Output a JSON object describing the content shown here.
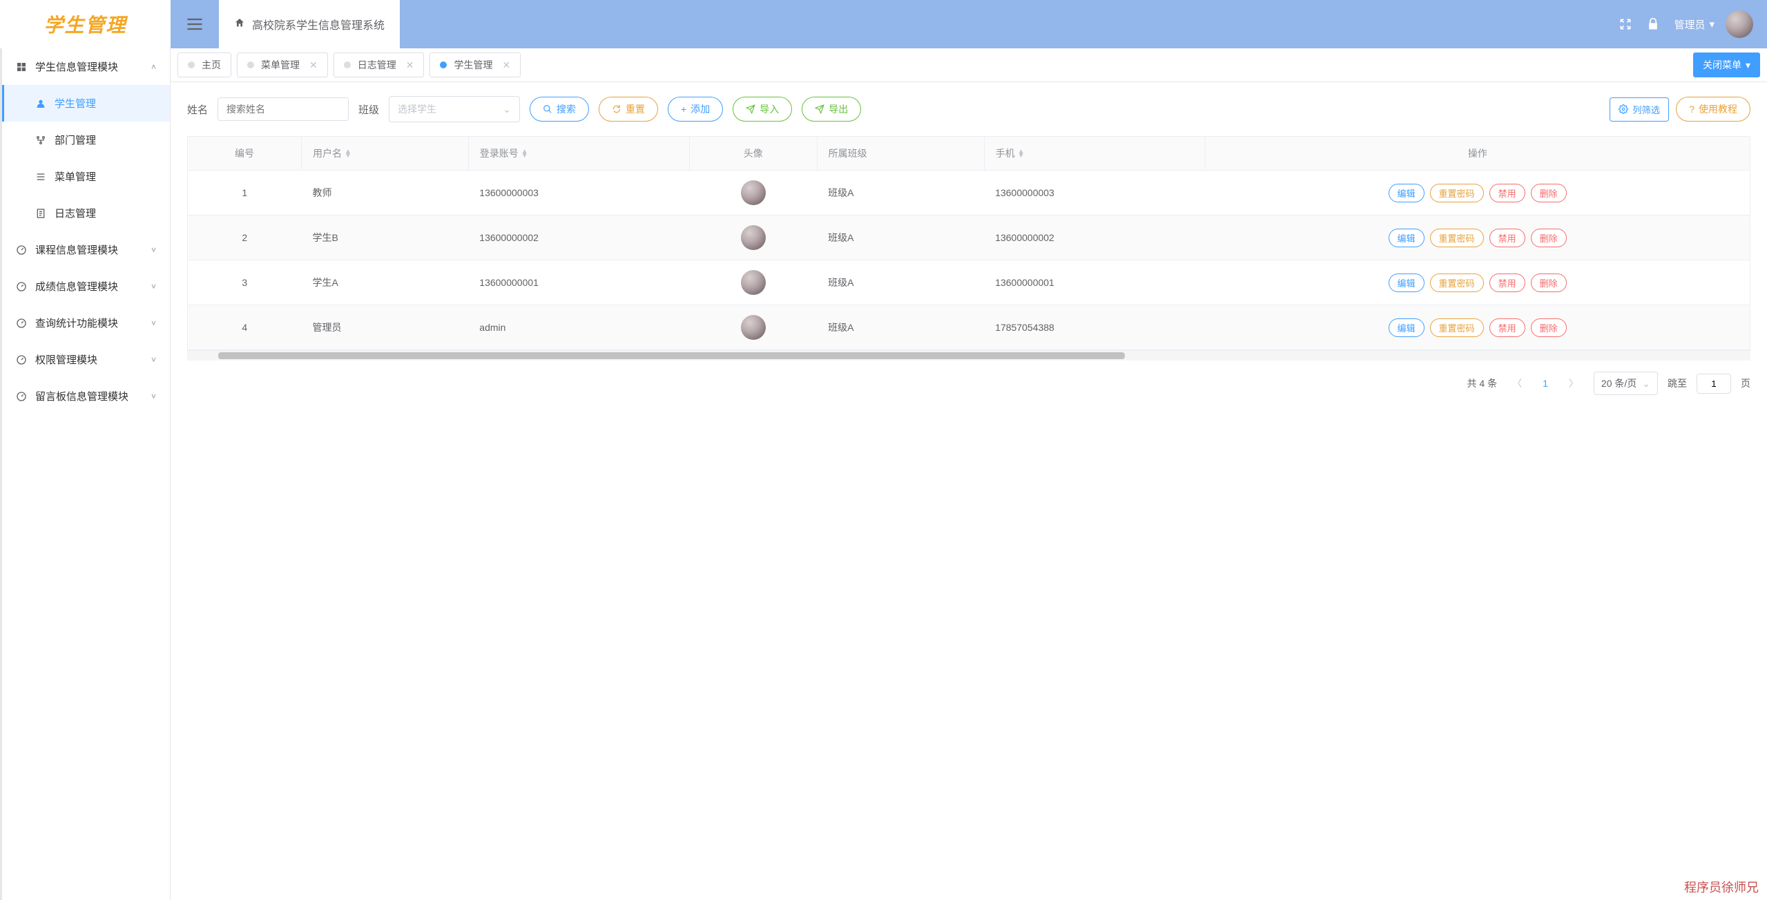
{
  "logo": "学生管理",
  "breadcrumb": "高校院系学生信息管理系统",
  "header": {
    "user_label": "管理员"
  },
  "sidebar": {
    "groups": [
      {
        "label": "学生信息管理模块",
        "expanded": true,
        "children": [
          {
            "label": "学生管理",
            "active": true,
            "icon": "user"
          },
          {
            "label": "部门管理",
            "icon": "branch"
          },
          {
            "label": "菜单管理",
            "icon": "list"
          },
          {
            "label": "日志管理",
            "icon": "doc"
          }
        ]
      },
      {
        "label": "课程信息管理模块",
        "expanded": false
      },
      {
        "label": "成绩信息管理模块",
        "expanded": false
      },
      {
        "label": "查询统计功能模块",
        "expanded": false
      },
      {
        "label": "权限管理模块",
        "expanded": false
      },
      {
        "label": "留言板信息管理模块",
        "expanded": false
      }
    ]
  },
  "tabs": {
    "items": [
      {
        "label": "主页",
        "closable": false,
        "active": false
      },
      {
        "label": "菜单管理",
        "closable": true,
        "active": false
      },
      {
        "label": "日志管理",
        "closable": true,
        "active": false
      },
      {
        "label": "学生管理",
        "closable": true,
        "active": true
      }
    ],
    "close_menu": "关闭菜单"
  },
  "toolbar": {
    "name_label": "姓名",
    "name_placeholder": "搜索姓名",
    "class_label": "班级",
    "class_placeholder": "选择学生",
    "search": "搜索",
    "reset": "重置",
    "add": "添加",
    "import": "导入",
    "export": "导出",
    "filter": "列筛选",
    "tutorial": "使用教程"
  },
  "table": {
    "columns": {
      "id": "编号",
      "username": "用户名",
      "account": "登录账号",
      "avatar": "头像",
      "class": "所属班级",
      "phone": "手机",
      "ops": "操作"
    },
    "op_labels": {
      "edit": "编辑",
      "reset_pwd": "重置密码",
      "disable": "禁用",
      "delete": "删除"
    },
    "rows": [
      {
        "id": "1",
        "username": "教师",
        "account": "13600000003",
        "class": "班级A",
        "phone": "13600000003"
      },
      {
        "id": "2",
        "username": "学生B",
        "account": "13600000002",
        "class": "班级A",
        "phone": "13600000002"
      },
      {
        "id": "3",
        "username": "学生A",
        "account": "13600000001",
        "class": "班级A",
        "phone": "13600000001"
      },
      {
        "id": "4",
        "username": "管理员",
        "account": "admin",
        "class": "班级A",
        "phone": "17857054388"
      }
    ]
  },
  "pagination": {
    "total_text": "共 4 条",
    "current": "1",
    "page_size": "20 条/页",
    "jump_label": "跳至",
    "jump_value": "1",
    "page_suffix": "页"
  },
  "watermark": "程序员徐师兄"
}
